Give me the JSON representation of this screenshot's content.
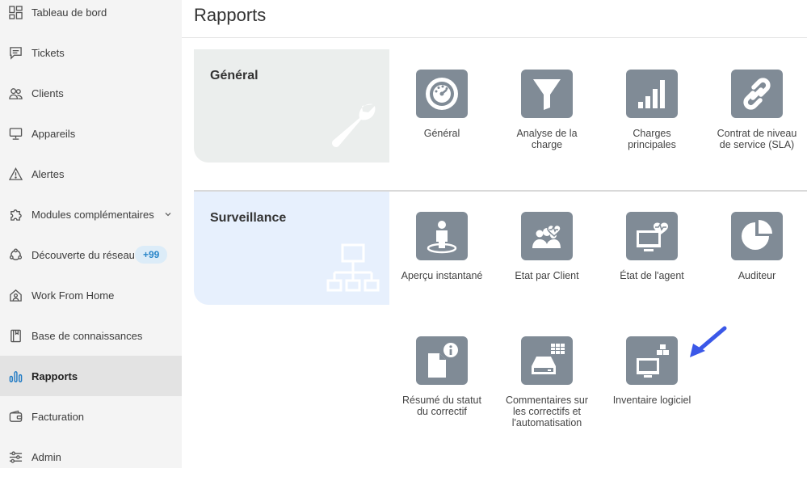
{
  "sidebar": {
    "items": [
      {
        "label": "Tableau de bord",
        "icon": "dashboard-icon"
      },
      {
        "label": "Tickets",
        "icon": "ticket-icon"
      },
      {
        "label": "Clients",
        "icon": "clients-icon"
      },
      {
        "label": "Appareils",
        "icon": "monitor-icon"
      },
      {
        "label": "Alertes",
        "icon": "alert-triangle-icon"
      },
      {
        "label": "Modules complémentaires",
        "icon": "puzzle-icon"
      },
      {
        "label": "Découverte du réseau",
        "icon": "network-discovery-icon",
        "badge": "+99"
      },
      {
        "label": "Work From Home",
        "icon": "home-user-icon"
      },
      {
        "label": "Base de connaissances",
        "icon": "book-icon"
      },
      {
        "label": "Rapports",
        "icon": "bar-chart-icon",
        "active": true
      },
      {
        "label": "Facturation",
        "icon": "wallet-icon"
      },
      {
        "label": "Admin",
        "icon": "sliders-icon"
      }
    ]
  },
  "page": {
    "title": "Rapports"
  },
  "sections": {
    "general": {
      "title": "Général",
      "tiles": [
        {
          "label": "Général",
          "icon": "gauge-icon"
        },
        {
          "label": "Analyse de la charge",
          "icon": "funnel-icon"
        },
        {
          "label": "Charges principales",
          "icon": "signal-bars-icon"
        },
        {
          "label": "Contrat de niveau de service (SLA)",
          "icon": "link-icon"
        }
      ]
    },
    "surveillance": {
      "title": "Surveillance",
      "tiles": [
        {
          "label": "Aperçu instantané",
          "icon": "person-snapshot-icon"
        },
        {
          "label": "Etat par Client",
          "icon": "group-health-icon"
        },
        {
          "label": "État de l'agent",
          "icon": "monitor-health-icon"
        },
        {
          "label": "Auditeur",
          "icon": "pie-chart-icon"
        },
        {
          "label": "Résumé du statut du correctif",
          "icon": "document-info-icon"
        },
        {
          "label": "Commentaires sur les correctifs et l'automatisation",
          "icon": "drive-table-icon"
        },
        {
          "label": "Inventaire logiciel",
          "icon": "monitor-boxes-icon"
        }
      ]
    }
  },
  "colors": {
    "tile": "#808b96",
    "accent": "#3b58e8",
    "badge_text": "#2a86c9"
  }
}
